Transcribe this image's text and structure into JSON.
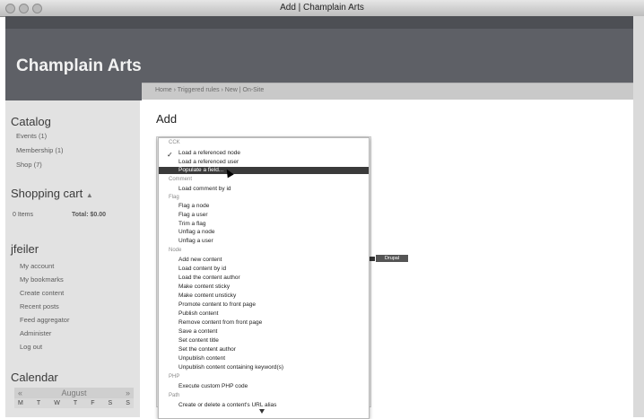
{
  "window": {
    "title": "Add | Champlain Arts"
  },
  "site": {
    "name": "Champlain Arts"
  },
  "breadcrumb": "Home › Triggered rules › New | On-Site",
  "page": {
    "title": "Add"
  },
  "sidebar": {
    "catalog": {
      "title": "Catalog",
      "items": [
        "Events (1)",
        "Membership (1)",
        "Shop (7)"
      ]
    },
    "cart": {
      "title": "Shopping cart",
      "toggle": "▲",
      "items_label": "0 Items",
      "total_label": "Total: $0.00"
    },
    "user": {
      "title": "jfeiler",
      "links": [
        "My account",
        "My bookmarks",
        "Create content",
        "Recent posts",
        "Feed aggregator",
        "Administer",
        "Log out"
      ]
    },
    "calendar": {
      "title": "Calendar",
      "month": "August",
      "prev": "«",
      "next": "»",
      "days": [
        "M",
        "T",
        "W",
        "T",
        "F",
        "S",
        "S"
      ]
    }
  },
  "dropdown": {
    "check_icon": "checkmark-icon",
    "selected_label": "Populate a field...",
    "groups": [
      {
        "label": "CCK",
        "items": [
          "Load a referenced node",
          "Load a referenced user"
        ]
      },
      {
        "label": "Comment",
        "items": [
          "Load comment by id"
        ]
      },
      {
        "label": "Flag",
        "items": [
          "Flag a node",
          "Flag a user",
          "Trim a flag",
          "Unflag a node",
          "Unflag a user"
        ]
      },
      {
        "label": "Node",
        "items": [
          "Add new content",
          "Load content by id",
          "Load the content author",
          "Make content sticky",
          "Make content unsticky",
          "Promote content to front page",
          "Publish content",
          "Remove content from front page",
          "Save a content",
          "Set content title",
          "Set the content author",
          "Unpublish content",
          "Unpublish content containing keyword(s)"
        ]
      },
      {
        "label": "PHP",
        "items": [
          "Execute custom PHP code"
        ]
      },
      {
        "label": "Path",
        "items": [
          "Create or delete a content's URL alias"
        ]
      }
    ]
  },
  "badge": {
    "label": "Drupal"
  },
  "colors": {
    "header": "#5e6066",
    "sidebar": "#e2e2e2",
    "selection": "#3a3a3a"
  }
}
